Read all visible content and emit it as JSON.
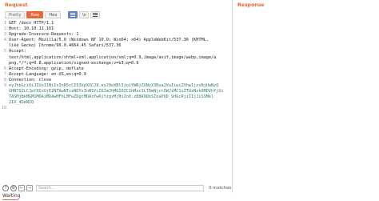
{
  "request": {
    "title": "Request",
    "buttons": {
      "pretty": "Pretty",
      "raw": "Raw",
      "hex": "Hex",
      "newline": "\\n"
    },
    "lines": [
      {
        "n": "1",
        "text": "GET /docs HTTP/1.1"
      },
      {
        "n": "2",
        "text": "Host: 10.10.11.161"
      },
      {
        "n": "3",
        "text": "Upgrade-Insecure-Requests: 1"
      },
      {
        "n": "4",
        "text": "User-Agent: Mozilla/5.0 (Windows NT 10.0; Win64; x64) AppleWebKit/537.36 (KHTML,"
      },
      {
        "n": "",
        "text": "like Gecko) Chrome/96.0.4664.45 Safari/537.36"
      },
      {
        "n": "5",
        "text": "Accept:"
      },
      {
        "n": "",
        "text": "text/html,application/xhtml+xml,application/xml;q=0.9,image/avif,image/webp,image/a"
      },
      {
        "n": "",
        "text": "png,*/*;q=0.8,application/signed-exchange;v=b3;q=0.9"
      },
      {
        "n": "6",
        "text": "Accept-Encoding: gzip, deflate"
      },
      {
        "n": "7",
        "text": "Accept-Language: en-US,en;q=0.9"
      },
      {
        "n": "8",
        "text": "Connection: close"
      },
      {
        "n": "9",
        "text": "eyJhbGciOiJIUzI1NiIsInR5cCI6IkpXVCJ9.eyJ0eXBlIjoiYWNjZXNzX3Rva2VuIiwiZXhwIjoxNjUwNzQ"
      },
      {
        "n": "",
        "text": "GHNTQ2LCJpYXQiOjE2NTAwNTczNDYsInN1YiI6ImJhMGI0ZC1hMzc3LTRmNjctOWJiMC1iZTUzNzk0MDVhYjUi"
      },
      {
        "n": "",
        "text": "TASMjBkMGM1MDAiMDAwMFhLMFwZDgtMDAzYwRjYzgzMjBiIn0.zB8A9DbSZoaPUD_9dGcRjzIIjJiSSMkl"
      },
      {
        "n": "",
        "text": "2IX_4DeNIQ"
      },
      {
        "n": "10",
        "text": ""
      }
    ]
  },
  "response": {
    "title": "Response"
  },
  "search": {
    "placeholder": "Search...",
    "matches": "0 matches"
  },
  "status": "Waiting",
  "colors": {
    "accent": "#e8683a",
    "action_blue": "#5b86c7"
  }
}
